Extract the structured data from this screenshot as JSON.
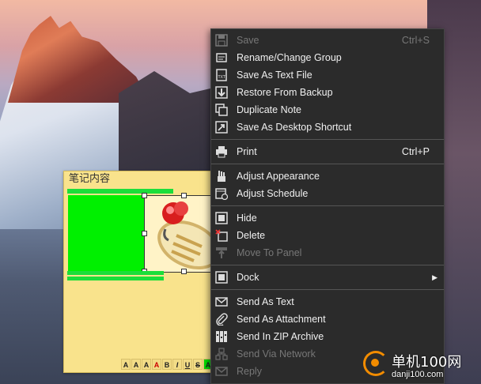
{
  "note": {
    "title": "笔记内容",
    "toolbar": [
      "A",
      "A",
      "A",
      "A",
      "B",
      "I",
      "U",
      "S",
      "A"
    ]
  },
  "menu": {
    "items": [
      {
        "label": "Save",
        "shortcut": "Ctrl+S",
        "icon": "save-icon",
        "disabled": true
      },
      {
        "label": "Rename/Change Group",
        "icon": "rename-icon"
      },
      {
        "label": "Save As Text File",
        "icon": "text-file-icon"
      },
      {
        "label": "Restore From Backup",
        "icon": "restore-icon"
      },
      {
        "label": "Duplicate Note",
        "icon": "duplicate-icon"
      },
      {
        "label": "Save As Desktop Shortcut",
        "icon": "shortcut-icon"
      },
      {
        "label": "Print",
        "shortcut": "Ctrl+P",
        "icon": "print-icon"
      },
      {
        "label": "Adjust Appearance",
        "icon": "appearance-icon"
      },
      {
        "label": "Adjust Schedule",
        "icon": "schedule-icon"
      },
      {
        "label": "Hide",
        "icon": "hide-icon"
      },
      {
        "label": "Delete",
        "icon": "delete-icon"
      },
      {
        "label": "Move To Panel",
        "icon": "move-to-panel-icon",
        "disabled": true
      },
      {
        "label": "Dock",
        "icon": "dock-icon",
        "submenu": true
      },
      {
        "label": "Send As Text",
        "icon": "mail-icon"
      },
      {
        "label": "Send As Attachment",
        "icon": "paperclip-icon"
      },
      {
        "label": "Send In ZIP Archive",
        "icon": "zip-icon"
      },
      {
        "label": "Send Via Network",
        "icon": "network-icon",
        "disabled": true
      },
      {
        "label": "Reply",
        "icon": "reply-icon",
        "disabled": true
      }
    ]
  },
  "watermark": {
    "cn": "单机100网",
    "url": "danji100.com"
  },
  "colors": {
    "menu_bg": "#2b2b2b",
    "note_bg": "#f9e38c",
    "note_green": "#00f000",
    "watermark_orange": "#f28c00"
  }
}
